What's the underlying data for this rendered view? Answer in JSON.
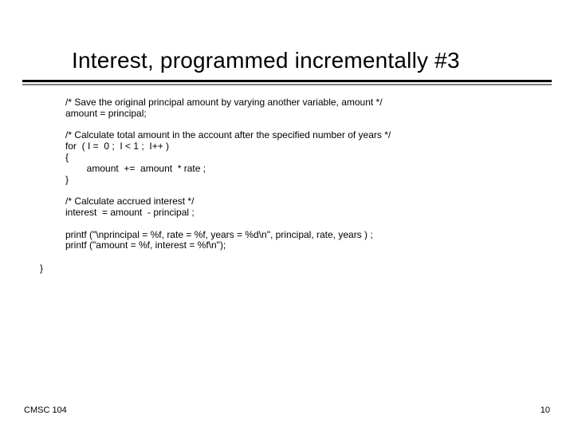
{
  "title": "Interest, programmed incrementally #3",
  "code": {
    "l1": "/* Save the original principal amount by varying another variable, amount */",
    "l2": "amount = principal;",
    "l3": "/* Calculate total amount in the account after the specified number of years */",
    "l4": "for  ( I =  0 ;  I < 1 ;  I++ )",
    "l5": "{",
    "l6": "        amount  +=  amount  * rate ;",
    "l7": "}",
    "l8": "/* Calculate accrued interest */",
    "l9": "interest  = amount  - principal ;",
    "l10": "printf (\"\\nprincipal = %f, rate = %f, years = %d\\n\", principal, rate, years ) ;",
    "l11": "printf (\"amount = %f, interest = %f\\n\");"
  },
  "closing": "}",
  "footer": {
    "left": "CMSC 104",
    "right": "10"
  }
}
